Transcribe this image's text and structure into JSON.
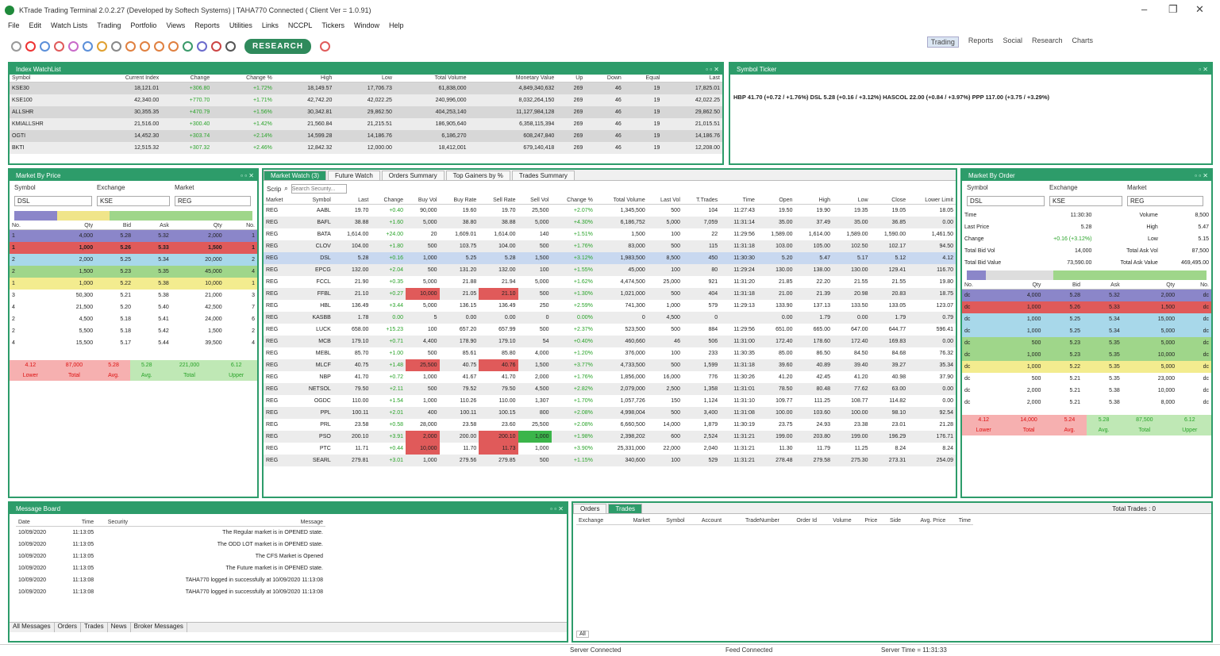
{
  "app": {
    "title": "KTrade Trading Terminal 2.0.2.27 (Developed by Softech Systems)  |  TAHA770 Connected ( Client Ver = 1.0.91)",
    "min": "–",
    "max": "❐",
    "close": "✕"
  },
  "menu": [
    "File",
    "Edit",
    "Watch Lists",
    "Trading",
    "Portfolio",
    "Views",
    "Reports",
    "Utilities",
    "Links",
    "NCCPL",
    "Tickers",
    "Window",
    "Help"
  ],
  "toolbar": {
    "research": "RESEARCH"
  },
  "workspaces": [
    "Trading",
    "Reports",
    "Social",
    "Research",
    "Charts"
  ],
  "index_watch": {
    "title": "Index WatchList",
    "cols": [
      "Symbol",
      "Current Index",
      "Change",
      "Change %",
      "High",
      "Low",
      "Total Volume",
      "Monetary Value",
      "Up",
      "Down",
      "Equal",
      "Last"
    ],
    "rows": [
      [
        "KSE30",
        "18,121.01",
        "+306.80",
        "+1.72%",
        "18,149.57",
        "17,706.73",
        "61,838,000",
        "4,849,340,632",
        "269",
        "46",
        "19",
        "17,825.01"
      ],
      [
        "KSE100",
        "42,340.00",
        "+770.70",
        "+1.71%",
        "42,742.20",
        "42,022.25",
        "240,996,000",
        "8,032,264,150",
        "269",
        "46",
        "19",
        "42,022.25"
      ],
      [
        "ALLSHR",
        "30,355.35",
        "+470.79",
        "+1.56%",
        "30,342.81",
        "29,862.50",
        "404,253,140",
        "11,127,984,128",
        "269",
        "46",
        "19",
        "29,862.50"
      ],
      [
        "KMIALLSHR",
        "21,516.00",
        "+300.40",
        "+1.42%",
        "21,560.84",
        "21,215.51",
        "186,905,640",
        "6,358,115,394",
        "269",
        "46",
        "19",
        "21,015.51"
      ],
      [
        "OGTI",
        "14,452.30",
        "+303.74",
        "+2.14%",
        "14,599.28",
        "14,186.76",
        "6,186,270",
        "608,247,840",
        "269",
        "46",
        "19",
        "14,186.76"
      ],
      [
        "BKTI",
        "12,515.32",
        "+307.32",
        "+2.46%",
        "12,842.32",
        "12,000.00",
        "18,412,001",
        "679,140,418",
        "269",
        "46",
        "19",
        "12,208.00"
      ]
    ]
  },
  "ticker": {
    "title": "Symbol Ticker",
    "text": "HBP  41.70 (+0.72 / +1.76%)     DSL  5.28 (+0.16 / +3.12%)     HASCOL  22.00 (+0.84 / +3.97%)     PPP  117.00 (+3.75 / +3.29%)"
  },
  "mbp": {
    "title": "Market By Price",
    "labels": [
      "Symbol",
      "Exchange",
      "Market"
    ],
    "values": [
      "DSL",
      "KSE",
      "REG"
    ],
    "cols": [
      "No.",
      "Qty",
      "Bid",
      "Ask",
      "Qty",
      "No."
    ],
    "rows": [
      [
        "1",
        "4,000",
        "5.28",
        "5.32",
        "2,000",
        "1"
      ],
      [
        "1",
        "1,000",
        "5.26",
        "5.33",
        "1,500",
        "1"
      ],
      [
        "2",
        "2,000",
        "5.25",
        "5.34",
        "20,000",
        "2"
      ],
      [
        "2",
        "1,500",
        "5.23",
        "5.35",
        "45,000",
        "4"
      ],
      [
        "1",
        "1,000",
        "5.22",
        "5.38",
        "10,000",
        "1"
      ],
      [
        "3",
        "50,300",
        "5.21",
        "5.38",
        "21,000",
        "3"
      ],
      [
        "4",
        "21,500",
        "5.20",
        "5.40",
        "42,500",
        "7"
      ],
      [
        "2",
        "4,500",
        "5.18",
        "5.41",
        "24,000",
        "6"
      ],
      [
        "2",
        "5,500",
        "5.18",
        "5.42",
        "1,500",
        "2"
      ],
      [
        "4",
        "15,500",
        "5.17",
        "5.44",
        "39,500",
        "4"
      ]
    ],
    "summary": [
      [
        "4.12",
        "87,000",
        "5.28",
        "5.28",
        "221,000",
        "6.12"
      ],
      [
        "Lower",
        "Total",
        "Avg.",
        "Avg.",
        "Total",
        "Upper"
      ]
    ]
  },
  "mw": {
    "tabs": [
      "Market Watch (3)",
      "Future Watch",
      "Orders Summary",
      "Top Gainers by %",
      "Trades Summary"
    ],
    "search_label": "Scrip",
    "search_placeholder": "Search Security...",
    "cols": [
      "Market",
      "Symbol",
      "Last",
      "Change",
      "Buy Vol",
      "Buy Rate",
      "Sell Rate",
      "Sell Vol",
      "Change %",
      "Total Volume",
      "Last Vol",
      "T.Trades",
      "Time",
      "Open",
      "High",
      "Low",
      "Close",
      "Lower Limit"
    ],
    "rows": [
      [
        "REG",
        "AABL",
        "19.70",
        "+0.40",
        "90,000",
        "19.60",
        "19.70",
        "25,500",
        "+2.07%",
        "1,345,500",
        "500",
        "104",
        "11:27:43",
        "19.50",
        "19.90",
        "19.35",
        "19.05",
        "18.05"
      ],
      [
        "REG",
        "BAFL",
        "38.88",
        "+1.60",
        "5,000",
        "38.80",
        "38.88",
        "5,000",
        "+4.30%",
        "6,186,752",
        "5,000",
        "7,059",
        "11:31:14",
        "35.00",
        "37.49",
        "35.00",
        "36.85",
        "0.00"
      ],
      [
        "REG",
        "BATA",
        "1,614.00",
        "+24.00",
        "20",
        "1,609.01",
        "1,614.00",
        "140",
        "+1.51%",
        "1,500",
        "100",
        "22",
        "11:29:56",
        "1,589.00",
        "1,614.00",
        "1,589.00",
        "1,590.00",
        "1,461.50"
      ],
      [
        "REG",
        "CLOV",
        "104.00",
        "+1.80",
        "500",
        "103.75",
        "104.00",
        "500",
        "+1.76%",
        "83,000",
        "500",
        "115",
        "11:31:18",
        "103.00",
        "105.00",
        "102.50",
        "102.17",
        "94.50"
      ],
      [
        "REG",
        "DSL",
        "5.28",
        "+0.16",
        "1,000",
        "5.25",
        "5.28",
        "1,500",
        "+3.12%",
        "1,983,500",
        "8,500",
        "450",
        "11:30:30",
        "5.20",
        "5.47",
        "5.17",
        "5.12",
        "4.12"
      ],
      [
        "REG",
        "EPCG",
        "132.00",
        "+2.04",
        "500",
        "131.20",
        "132.00",
        "100",
        "+1.55%",
        "45,000",
        "100",
        "80",
        "11:29:24",
        "130.00",
        "138.00",
        "130.00",
        "129.41",
        "116.70"
      ],
      [
        "REG",
        "FCCL",
        "21.90",
        "+0.35",
        "5,000",
        "21.88",
        "21.94",
        "5,000",
        "+1.62%",
        "4,474,500",
        "25,000",
        "921",
        "11:31:20",
        "21.85",
        "22.20",
        "21.55",
        "21.55",
        "19.80"
      ],
      [
        "REG",
        "FFBL",
        "21.10",
        "+0.27",
        "10,000",
        "21.05",
        "21.10",
        "500",
        "+1.30%",
        "1,021,000",
        "500",
        "404",
        "11:31:18",
        "21.00",
        "21.39",
        "20.98",
        "20.83",
        "18.75"
      ],
      [
        "REG",
        "HBL",
        "136.49",
        "+3.44",
        "5,000",
        "136.15",
        "136.49",
        "250",
        "+2.59%",
        "741,300",
        "1,000",
        "579",
        "11:29:13",
        "133.90",
        "137.13",
        "133.50",
        "133.05",
        "123.07"
      ],
      [
        "REG",
        "KASBB",
        "1.78",
        "0.00",
        "5",
        "0.00",
        "0.00",
        "0",
        "0.00%",
        "0",
        "4,500",
        "0",
        "",
        "0.00",
        "1.79",
        "0.00",
        "1.79",
        "0.79"
      ],
      [
        "REG",
        "LUCK",
        "658.00",
        "+15.23",
        "100",
        "657.20",
        "657.99",
        "500",
        "+2.37%",
        "523,500",
        "500",
        "884",
        "11:29:56",
        "651.00",
        "665.00",
        "647.00",
        "644.77",
        "596.41"
      ],
      [
        "REG",
        "MCB",
        "179.10",
        "+0.71",
        "4,400",
        "178.90",
        "179.10",
        "54",
        "+0.40%",
        "460,660",
        "46",
        "506",
        "11:31:00",
        "172.40",
        "178.60",
        "172.40",
        "169.83",
        "0.00"
      ],
      [
        "REG",
        "MEBL",
        "85.70",
        "+1.00",
        "500",
        "85.61",
        "85.80",
        "4,000",
        "+1.20%",
        "376,000",
        "100",
        "233",
        "11:30:35",
        "85.00",
        "86.50",
        "84.50",
        "84.68",
        "76.32"
      ],
      [
        "REG",
        "MLCF",
        "40.75",
        "+1.48",
        "25,500",
        "40.75",
        "40.76",
        "1,500",
        "+3.77%",
        "4,733,500",
        "500",
        "1,599",
        "11:31:18",
        "39.60",
        "40.89",
        "39.40",
        "39.27",
        "35.34"
      ],
      [
        "REG",
        "NBP",
        "41.70",
        "+0.72",
        "1,000",
        "41.67",
        "41.70",
        "2,000",
        "+1.76%",
        "1,856,000",
        "16,000",
        "776",
        "11:30:26",
        "41.20",
        "42.45",
        "41.20",
        "40.98",
        "37.90"
      ],
      [
        "REG",
        "NETSOL",
        "79.50",
        "+2.11",
        "500",
        "79.52",
        "79.50",
        "4,500",
        "+2.82%",
        "2,079,000",
        "2,500",
        "1,358",
        "11:31:01",
        "78.50",
        "80.48",
        "77.62",
        "63.00",
        "0.00"
      ],
      [
        "REG",
        "OGDC",
        "110.00",
        "+1.54",
        "1,000",
        "110.26",
        "110.00",
        "1,307",
        "+1.70%",
        "1,057,726",
        "150",
        "1,124",
        "11:31:10",
        "109.77",
        "111.25",
        "108.77",
        "114.82",
        "0.00"
      ],
      [
        "REG",
        "PPL",
        "100.11",
        "+2.01",
        "400",
        "100.11",
        "100.15",
        "800",
        "+2.08%",
        "4,998,004",
        "500",
        "3,400",
        "11:31:08",
        "100.00",
        "103.60",
        "100.00",
        "98.10",
        "92.54"
      ],
      [
        "REG",
        "PRL",
        "23.58",
        "+0.58",
        "28,000",
        "23.58",
        "23.60",
        "25,500",
        "+2.08%",
        "6,660,500",
        "14,000",
        "1,879",
        "11:30:19",
        "23.75",
        "24.93",
        "23.38",
        "23.01",
        "21.28"
      ],
      [
        "REG",
        "PSO",
        "200.10",
        "+3.91",
        "2,000",
        "200.00",
        "200.10",
        "1,000",
        "+1.98%",
        "2,398,202",
        "600",
        "2,524",
        "11:31:21",
        "199.00",
        "203.80",
        "199.00",
        "196.29",
        "176.71"
      ],
      [
        "REG",
        "PTC",
        "11.71",
        "+0.44",
        "10,000",
        "11.70",
        "11.73",
        "1,000",
        "+3.90%",
        "25,331,000",
        "22,000",
        "2,040",
        "11:31:21",
        "11.30",
        "11.79",
        "11.25",
        "8.24",
        "8.24"
      ],
      [
        "REG",
        "SEARL",
        "279.81",
        "+3.01",
        "1,000",
        "279.56",
        "279.85",
        "500",
        "+1.15%",
        "340,600",
        "100",
        "529",
        "11:31:21",
        "278.48",
        "279.58",
        "275.30",
        "273.31",
        "254.09"
      ]
    ]
  },
  "mbo": {
    "title": "Market By Order",
    "labels": [
      "Symbol",
      "Exchange",
      "Market"
    ],
    "values": [
      "DSL",
      "KSE",
      "REG"
    ],
    "info": [
      [
        "Time",
        "11:30:30",
        "Volume",
        "8,500"
      ],
      [
        "Last Price",
        "5.28",
        "High",
        "5.47"
      ],
      [
        "Change",
        "+0.16 (+3.12%)",
        "Low",
        "5.15"
      ],
      [
        "Total Bid Vol",
        "14,000",
        "Total Ask Vol",
        "87,500"
      ],
      [
        "Total Bid Value",
        "73,590.00",
        "Total Ask Value",
        "469,495.00"
      ]
    ],
    "cols": [
      "No.",
      "Qty",
      "Bid",
      "Ask",
      "Qty",
      "No."
    ],
    "rows": [
      [
        "dc",
        "4,000",
        "5.28",
        "5.32",
        "2,000",
        "dc"
      ],
      [
        "dc",
        "1,000",
        "5.26",
        "5.33",
        "1,500",
        "dc"
      ],
      [
        "dc",
        "1,000",
        "5.25",
        "5.34",
        "15,000",
        "dc"
      ],
      [
        "dc",
        "1,000",
        "5.25",
        "5.34",
        "5,000",
        "dc"
      ],
      [
        "dc",
        "500",
        "5.23",
        "5.35",
        "5,000",
        "dc"
      ],
      [
        "dc",
        "1,000",
        "5.23",
        "5.35",
        "10,000",
        "dc"
      ],
      [
        "dc",
        "1,000",
        "5.22",
        "5.35",
        "5,000",
        "dc"
      ],
      [
        "dc",
        "500",
        "5.21",
        "5.35",
        "23,000",
        "dc"
      ],
      [
        "dc",
        "2,000",
        "5.21",
        "5.38",
        "10,000",
        "dc"
      ],
      [
        "dc",
        "2,000",
        "5.21",
        "5.38",
        "8,000",
        "dc"
      ]
    ],
    "summary": [
      [
        "4.12",
        "14,000",
        "5.24",
        "5.28",
        "87,500",
        "6.12"
      ],
      [
        "Lower",
        "Total",
        "Avg.",
        "Avg.",
        "Total",
        "Upper"
      ]
    ]
  },
  "msg": {
    "title": "Message Board",
    "cols": [
      "Date",
      "Time",
      "Security",
      "Message"
    ],
    "rows": [
      [
        "10/09/2020",
        "11:13:05",
        "",
        "The Regular market is in OPENED state."
      ],
      [
        "10/09/2020",
        "11:13:05",
        "",
        "The ODD LOT market is in OPENED state."
      ],
      [
        "10/09/2020",
        "11:13:05",
        "",
        "The CFS Market is Opened"
      ],
      [
        "10/09/2020",
        "11:13:05",
        "",
        "The Future market is in OPENED state."
      ],
      [
        "10/09/2020",
        "11:13:08",
        "",
        "TAHA770 logged in successfully at 10/09/2020 11:13:08"
      ],
      [
        "10/09/2020",
        "11:13:08",
        "",
        "TAHA770 logged in successfully at 10/09/2020 11:13:08"
      ]
    ],
    "tabs": [
      "All Messages",
      "Orders",
      "Trades",
      "News",
      "Broker Messages"
    ]
  },
  "trades": {
    "tabs": [
      "Orders",
      "Trades"
    ],
    "total": "Total Trades : 0",
    "cols": [
      "Exchange",
      "Market",
      "Symbol",
      "Account",
      "TradeNumber",
      "Order Id",
      "Volume",
      "Price",
      "Side",
      "Avg. Price",
      "Time"
    ],
    "footer": "All"
  },
  "status": {
    "server": "Server Connected",
    "feed": "Feed Connected",
    "time": "Server Time = 11:31:33"
  }
}
